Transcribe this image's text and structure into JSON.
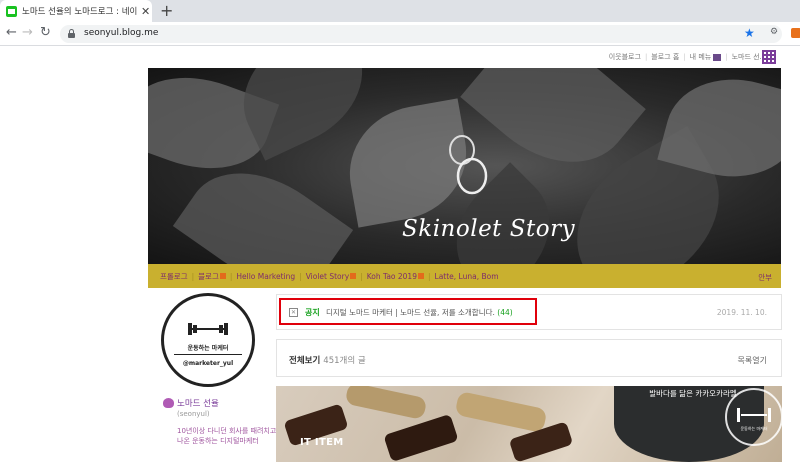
{
  "browser": {
    "tab_title": "노마드 선율의 노마드로그 : 네이",
    "url": "seonyul.blog.me",
    "icons": [
      "back-arrow-icon",
      "forward-arrow-icon",
      "reload-icon",
      "lock-icon",
      "star-icon",
      "close-icon",
      "new-tab-icon"
    ]
  },
  "blog_header": {
    "links": [
      "이웃블로그",
      "블로그 홈",
      "내 메뉴",
      "노마드 선.."
    ],
    "banner_title": "Skinolet Story"
  },
  "menu": {
    "items": [
      "프롤로그",
      "블로그",
      "Hello Marketing",
      "Violet Story",
      "Koh Tao 2019",
      "Latte, Luna, Bom"
    ],
    "right_label": "안부"
  },
  "profile": {
    "badge_line1": "운동하는 마케터",
    "badge_line2": "@marketer_yul",
    "nickname": "노마드 선율",
    "blog_id": "(seonyul)",
    "intro": "10년이상 다니던 회사를 때려치고 나온 운동하는 디지털마케터"
  },
  "notice": {
    "label": "공지",
    "text": "디지털 노마드 마케터 | 노마드 선율, 저를 소개합니다.",
    "count": "(44)",
    "date": "2019. 11. 10."
  },
  "all_posts": {
    "title": "전체보기",
    "count": "451개의 글",
    "toggle": "목록열기"
  },
  "post_preview": {
    "label": "IT ITEM",
    "jar_text": "발바다를 닮은 카카오카라멜",
    "watermark": "운동하는 마케터"
  },
  "colors": {
    "menu_bg": "#c9b02f",
    "menu_text": "#7d2c6b",
    "notice_green": "#18a11f",
    "highlight_red": "#e0000b",
    "accent_purple": "#7b3d9a"
  }
}
